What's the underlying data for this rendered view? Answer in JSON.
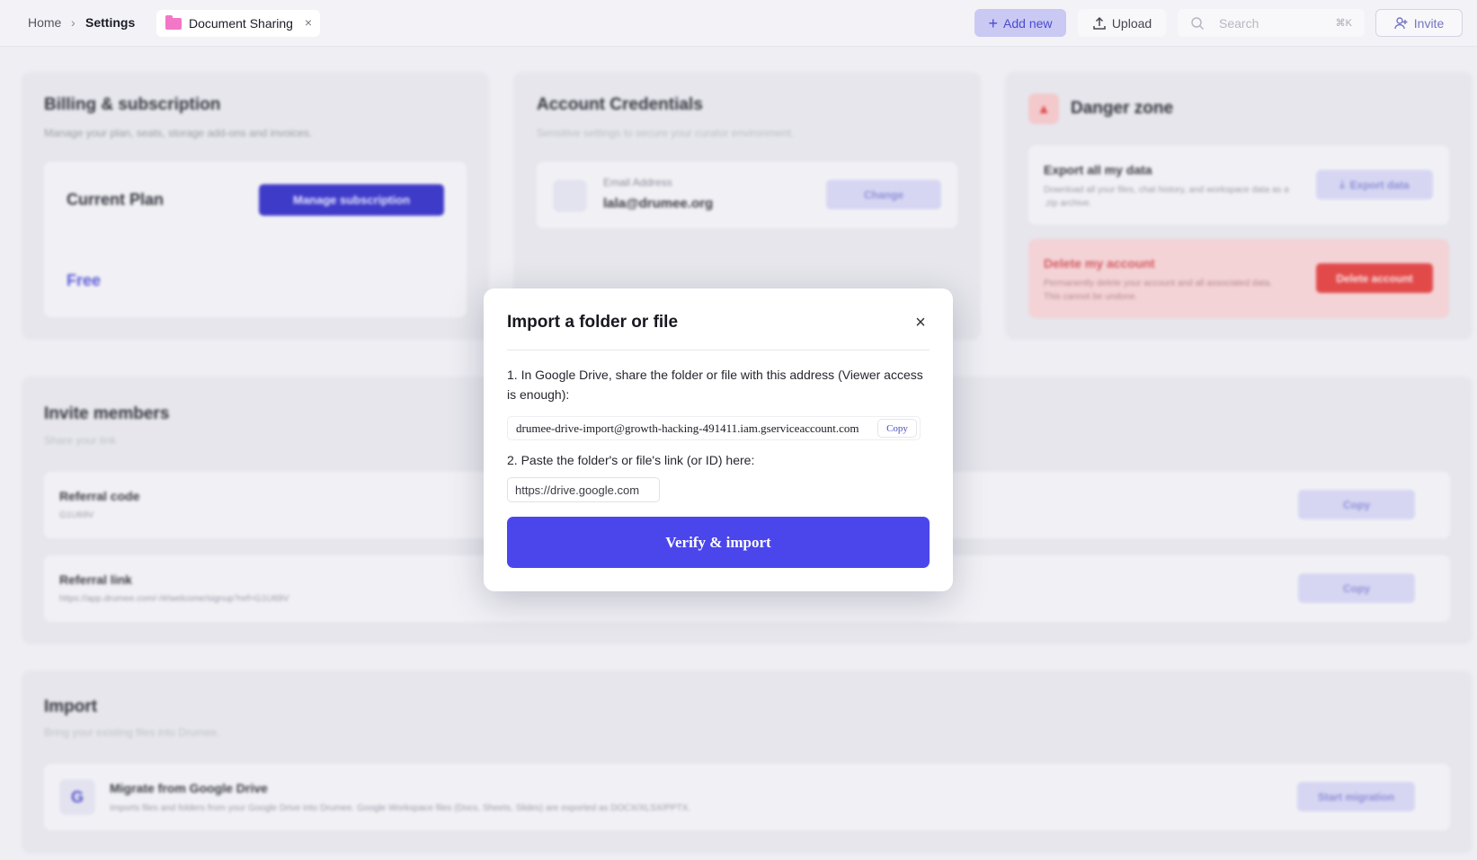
{
  "breadcrumb": {
    "home": "Home",
    "separator": "›",
    "settings": "Settings"
  },
  "tab": {
    "label": "Document Sharing",
    "close": "×",
    "icon": "folder-icon"
  },
  "toolbar": {
    "add_new": "Add new",
    "upload": "Upload",
    "search_placeholder": "Search",
    "search_shortcut": "⌘K",
    "invite": "Invite"
  },
  "billing": {
    "title": "Billing & subscription",
    "subtitle": "Manage your plan, seats, storage add-ons and invoices.",
    "current_plan_label": "Current Plan",
    "manage_button": "Manage subscription",
    "plan_name": "Free"
  },
  "credentials": {
    "title": "Account Credentials",
    "subtitle": "Sensitive settings to secure your curator environment.",
    "email_label": "Email Address",
    "email_value": "lala@drumee.org",
    "change_button": "Change"
  },
  "danger": {
    "title": "Danger zone",
    "export_title": "Export all my data",
    "export_desc": "Download all your files, chat history, and workspace data as a .zip archive.",
    "export_button": "Export data",
    "delete_title": "Delete my account",
    "delete_desc": "Permanently delete your account and all associated data. This cannot be undone.",
    "delete_button": "Delete account"
  },
  "invite": {
    "title": "Invite members",
    "subtitle": "Share your link",
    "referral_code_label": "Referral code",
    "referral_code_value": "G1U69V",
    "referral_link_label": "Referral link",
    "referral_link_value": "https://app.drumee.com/-/#/welcome/signup?ref=G1U69V",
    "copy_button": "Copy"
  },
  "import": {
    "title": "Import",
    "subtitle": "Bring your existing files into Drumee.",
    "google_letter": "G",
    "migrate_title": "Migrate from Google Drive",
    "migrate_desc": "Imports files and folders from your Google Drive into Drumee. Google Workspace files (Docs, Sheets, Slides) are exported as DOCX/XLSX/PPTX.",
    "start_button": "Start migration"
  },
  "modal": {
    "title": "Import a folder or file",
    "close": "×",
    "step1": "1. In Google Drive, share the folder or file with this address (Viewer access is enough):",
    "service_address": "drumee-drive-import@growth-hacking-491411.iam.gserviceaccount.com",
    "copy_label": "Copy",
    "step2": "2. Paste the folder's or file's link (or ID) here:",
    "link_placeholder": "https://drive.google.com",
    "verify_button": "Verify & import"
  },
  "colors": {
    "accent": "#4a46ec",
    "danger": "#e24a4a",
    "brand_pink": "#f277c6"
  }
}
